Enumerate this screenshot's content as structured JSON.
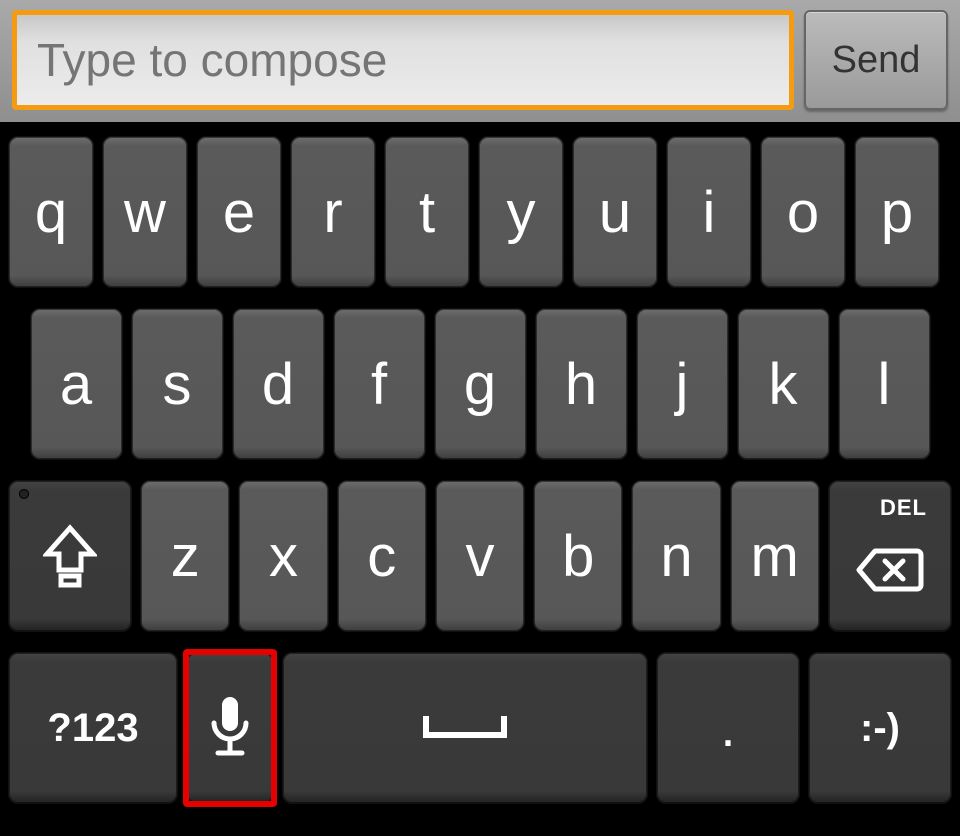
{
  "compose": {
    "placeholder": "Type to compose",
    "value": ""
  },
  "send": {
    "label": "Send"
  },
  "rows": {
    "r1": [
      "q",
      "w",
      "e",
      "r",
      "t",
      "y",
      "u",
      "i",
      "o",
      "p"
    ],
    "r2": [
      "a",
      "s",
      "d",
      "f",
      "g",
      "h",
      "j",
      "k",
      "l"
    ],
    "r3": [
      "z",
      "x",
      "c",
      "v",
      "b",
      "n",
      "m"
    ]
  },
  "del_hint": "DEL",
  "sym_label": "?123",
  "smiley_label": ":-)",
  "period_label": "."
}
